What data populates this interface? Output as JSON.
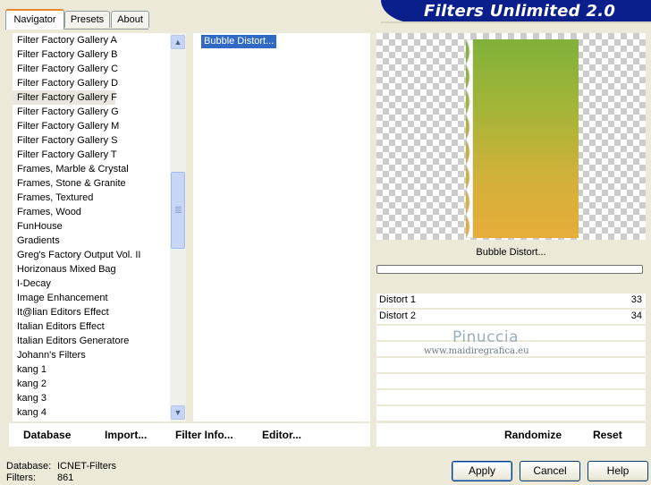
{
  "tabs": [
    "Navigator",
    "Presets",
    "About"
  ],
  "header": {
    "title": "Filters Unlimited 2.0"
  },
  "categories": [
    "Filter Factory Gallery A",
    "Filter Factory Gallery B",
    "Filter Factory Gallery C",
    "Filter Factory Gallery D",
    "Filter Factory Gallery F",
    "Filter Factory Gallery G",
    "Filter Factory Gallery M",
    "Filter Factory Gallery S",
    "Filter Factory Gallery T",
    "Frames, Marble & Crystal",
    "Frames, Stone & Granite",
    "Frames, Textured",
    "Frames, Wood",
    "FunHouse",
    "Gradients",
    "Greg's Factory Output Vol. II",
    "Horizonaus Mixed Bag",
    "I-Decay",
    "Image Enhancement",
    "It@lian Editors Effect",
    "Italian Editors Effect",
    "Italian Editors Generatore",
    "Johann's Filters",
    "kang 1",
    "kang 2",
    "kang 3",
    "kang 4"
  ],
  "selected_category": "Filter Factory Gallery F",
  "filters": [
    "Bubble Distort..."
  ],
  "preview": {
    "label": "Bubble Distort..."
  },
  "params": [
    {
      "name": "Distort 1",
      "value": "33"
    },
    {
      "name": "Distort 2",
      "value": "34"
    }
  ],
  "watermark": {
    "line1": "Pinuccia",
    "line2": "www.maidiregrafica.eu"
  },
  "toolbar": {
    "database": "Database",
    "import": "Import...",
    "filter_info": "Filter Info...",
    "editor": "Editor...",
    "randomize": "Randomize",
    "reset": "Reset"
  },
  "status": {
    "database_label": "Database:",
    "database_value": "ICNET-Filters",
    "filters_label": "Filters:",
    "filters_value": "861"
  },
  "buttons": {
    "apply": "Apply",
    "cancel": "Cancel",
    "help": "Help"
  },
  "colors": {
    "selection": "#316ac5",
    "banner": "#0a1e8c",
    "tab_accent": "#e68b2c"
  }
}
